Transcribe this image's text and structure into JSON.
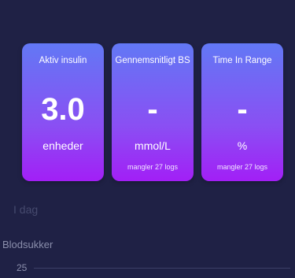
{
  "cards": [
    {
      "title": "Aktiv insulin",
      "value": "3.0",
      "unit": "enheder",
      "note": ""
    },
    {
      "title": "Gennemsnitligt BS",
      "value": "-",
      "unit": "mmol/L",
      "note": "mangler 27 logs"
    },
    {
      "title": "Time In Range",
      "value": "-",
      "unit": "%",
      "note": "mangler 27 logs"
    }
  ],
  "section": {
    "today_label": "I dag",
    "chart_title": "Blodsukker",
    "axis_label": "25"
  },
  "colors": {
    "background": "#1f2145",
    "card_gradient_top": "#6278f5",
    "card_gradient_bottom": "#a21ff6"
  }
}
